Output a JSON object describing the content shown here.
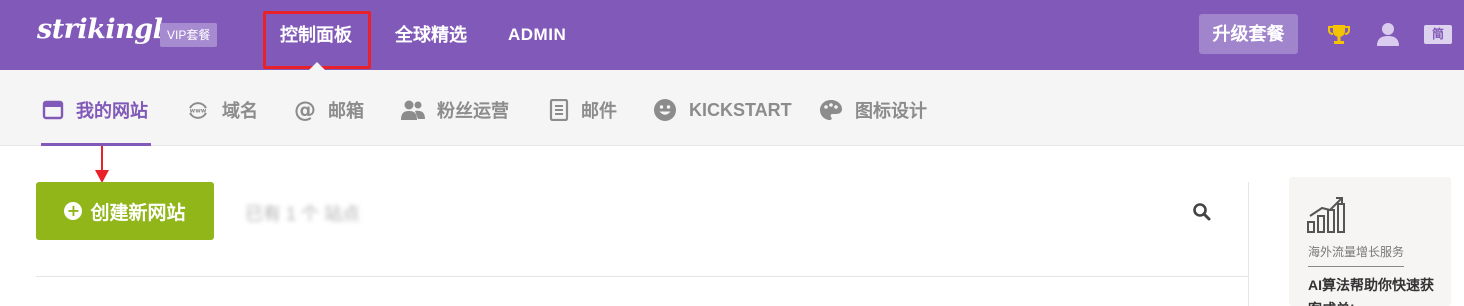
{
  "header": {
    "logo": "strikingly",
    "vip_badge": "VIP套餐",
    "nav": {
      "dashboard": "控制面板",
      "global_picks": "全球精选",
      "admin": "ADMIN"
    },
    "upgrade_label": "升级套餐",
    "lang_label": "简"
  },
  "tabs": [
    {
      "label": "我的网站",
      "icon": "browser-window-icon"
    },
    {
      "label": "域名",
      "icon": "www-icon"
    },
    {
      "label": "邮箱",
      "icon": "at-icon"
    },
    {
      "label": "粉丝运营",
      "icon": "users-icon"
    },
    {
      "label": "邮件",
      "icon": "document-icon"
    },
    {
      "label": "KICKSTART",
      "icon": "smiley-icon"
    },
    {
      "label": "图标设计",
      "icon": "palette-icon"
    }
  ],
  "main": {
    "create_label": "创建新网站",
    "search_text": "已有 1 个 站点"
  },
  "promo": {
    "title": "海外流量增长服务",
    "description": "AI算法帮助你快速获客成单!"
  },
  "colors": {
    "brand_purple": "#8159b8",
    "create_green": "#90b61a",
    "annotation_red": "#e8212a"
  }
}
